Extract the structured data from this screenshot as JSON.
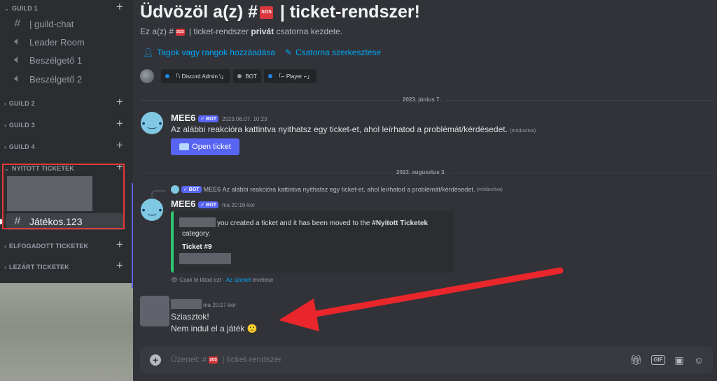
{
  "sidebar": {
    "categories": [
      {
        "name": "GUILD 1"
      },
      {
        "name": "GUILD 2"
      },
      {
        "name": "GUILD 3"
      },
      {
        "name": "GUILD 4"
      },
      {
        "name": "NYITOTT TICKETEK"
      },
      {
        "name": "ELFOGADOTT TICKETEK"
      },
      {
        "name": "LEZÁRT TICKETEK"
      }
    ],
    "channels": [
      {
        "name": "| guild-chat",
        "icon": "hash-icon"
      },
      {
        "name": "Leader Room",
        "icon": "speaker-icon"
      },
      {
        "name": "Beszélgető 1",
        "icon": "speaker-icon"
      },
      {
        "name": "Beszélgető 2",
        "icon": "speaker-icon"
      }
    ],
    "active_channel": {
      "name": "Játékos.123",
      "icon": "hash-icon"
    }
  },
  "welcome": {
    "title_prefix": "Üdvözöl a(z) #",
    "title_suffix": "| ticket-rendszer!",
    "sos_label": "SOS",
    "sub_prefix": "Ez a(z) #",
    "sub_middle": "| ticket-rendszer",
    "sub_bold": "privát",
    "sub_suffix": "csatorna kezdete.",
    "action_add": "Tagok vagy rangok hozzáadása",
    "action_edit": "Csatorna szerkesztése"
  },
  "roles": [
    {
      "label": "「\\ Discord Admin \\」",
      "color": "#1e88e5"
    },
    {
      "label": "BOT",
      "color": "#949ba4"
    },
    {
      "label": "「⌐ Player ⌐」",
      "color": "#1e88e5"
    }
  ],
  "dividers": {
    "first": "2023. június 7.",
    "second": "2023. augusztus 3."
  },
  "messages": {
    "m1": {
      "author": "MEE6",
      "badge": "✓ BOT",
      "timestamp": "2023.06.07. 10:23",
      "text": "Az alábbi reakcióra kattintva nyithatsz egy ticket-et, ahol leírhatod a problémát/kérdésedet.",
      "edited": "(módosítva)",
      "button": "Open ticket"
    },
    "reply": {
      "badge": "✓ BOT",
      "author": "MEE6",
      "text": "Az alábbi reakcióra kattintva nyithatsz egy ticket-et, ahol leírhatod a problémát/kérdésedet.",
      "edited": "(módosítva)"
    },
    "m2": {
      "author": "MEE6",
      "badge": "✓ BOT",
      "timestamp": "ma 20:16-kor",
      "embed_line1": "you created a ticket and it has been moved to the",
      "embed_bold": "#Nyitott Ticketek",
      "embed_line2": "category.",
      "embed_title": "Ticket #9",
      "only_you": "Csak te látod ezt ·",
      "dismiss_link": "Az üzenet",
      "dismiss_suffix": "elvetése"
    },
    "m3": {
      "timestamp": "ma 20:17-kor",
      "line1": "Sziasztok!",
      "line2": "Nem indul el a játék",
      "emoji": "🙁"
    }
  },
  "input": {
    "placeholder_prefix": "Üzenet: #",
    "placeholder_suffix": "| ticket-rendszer",
    "gif_label": "GIF"
  },
  "colors": {
    "accent": "#5865f2",
    "link": "#00a8fc",
    "highlight_box": "#e53935",
    "arrow": "#e8262b",
    "embed_bar": "#2dc770"
  }
}
